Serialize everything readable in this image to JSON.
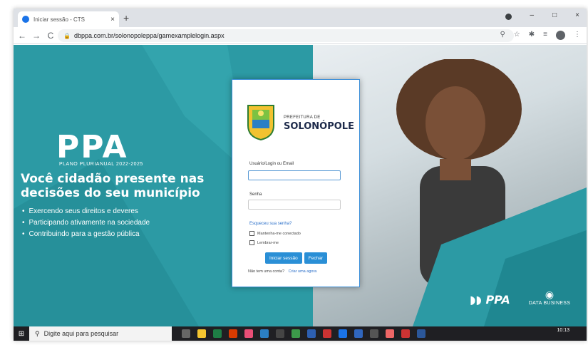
{
  "browser": {
    "tab_title": "Iniciar sessão - CTS",
    "tab_close": "×",
    "new_tab": "+",
    "back": "←",
    "forward": "→",
    "reload": "C",
    "url": "dbppa.com.br/solonopoleppa/gamexamplelogin.aspx"
  },
  "hero": {
    "logo": "PPA",
    "subtitle": "PLANO PLURIANUAL 2022-2025",
    "headline": "Você cidadão presente nas decisões do seu município",
    "bullets": [
      "Exercendo seus direitos e deveres",
      "Participando ativamente na sociedade",
      "Contribuindo para a gestão pública"
    ]
  },
  "login": {
    "pref_de": "PREFEITURA DE",
    "pref_name": "SOLONÓPOLE",
    "user_label": "Usuário/Login ou Email",
    "user_value": "",
    "pass_label": "Senha",
    "pass_value": "",
    "forgot": "Esqueceu sua senha?",
    "remember": "Mantenha-me conectado",
    "remind": "Lembrar-me",
    "signin": "Iniciar sessão",
    "close": "Fechar",
    "no_account": "Não tem uma conta?",
    "create": "Criar uma agora"
  },
  "footer_logos": {
    "ppa": "PPA",
    "databusiness": "DATA BUSINESS"
  },
  "taskbar": {
    "search_placeholder": "Digite aqui para pesquisar",
    "time": "10:13"
  },
  "colors": {
    "teal": "#2c9aa4",
    "accent_blue": "#2a8fd6",
    "dark_navy": "#1d2a4a"
  }
}
